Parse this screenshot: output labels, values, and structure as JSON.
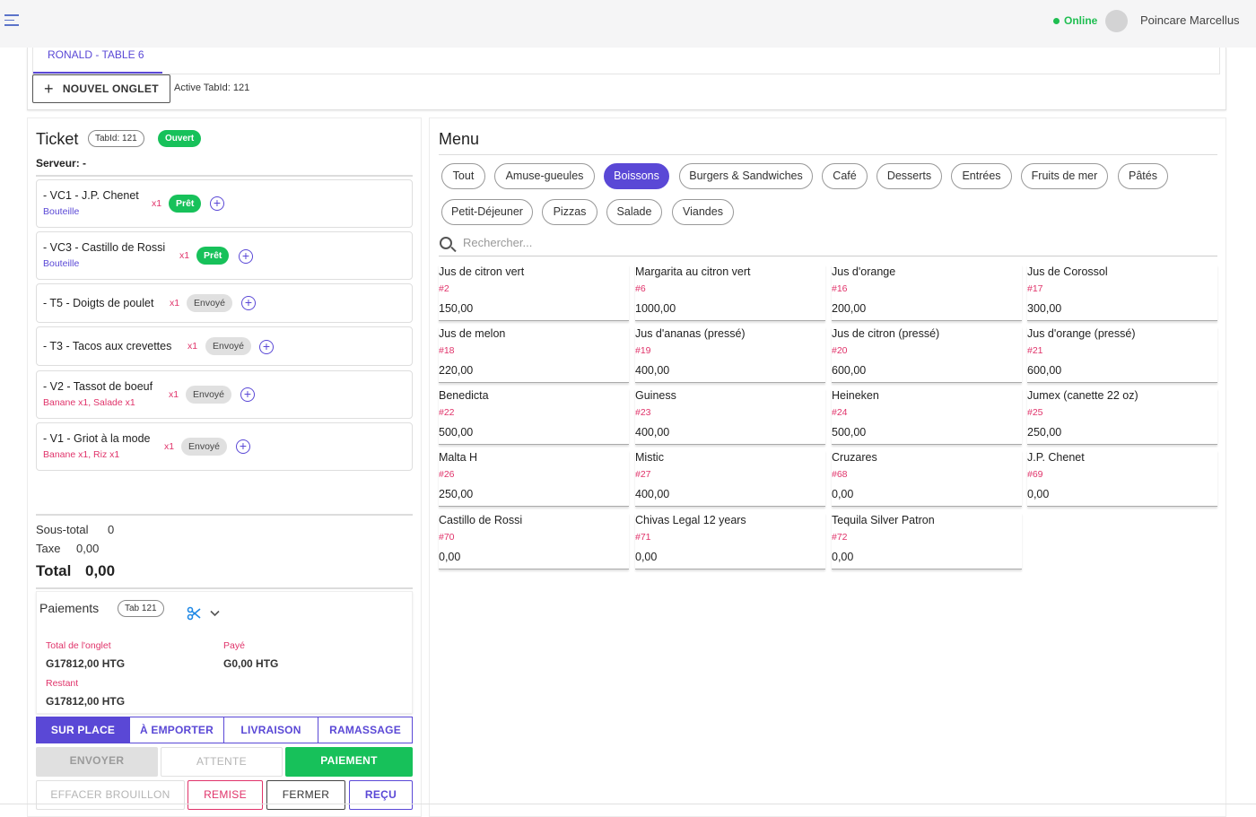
{
  "header": {
    "status": "Online",
    "user_name": "Poincare Marcellus"
  },
  "tabs": {
    "active_tab": "RONALD - TABLE 6",
    "new_tab_label": "NOUVEL ONGLET",
    "active_tabid_text": "Active TabId: 121"
  },
  "ticket": {
    "title": "Ticket",
    "tabid_chip": "TabId: 121",
    "status_chip": "Ouvert",
    "server": "Serveur: -",
    "items": [
      {
        "name": "- VC1 - J.P. Chenet",
        "sub": "Bouteille",
        "qty": "x1",
        "badge": "Prêt"
      },
      {
        "name": "- VC3 - Castillo de Rossi",
        "sub": "Bouteille",
        "qty": "x1",
        "badge": "Prêt"
      },
      {
        "name": "- T5 - Doigts de poulet",
        "sub": "",
        "qty": "x1",
        "badge": "Envoyé"
      },
      {
        "name": "- T3 - Tacos aux crevettes",
        "sub": "",
        "qty": "x1",
        "badge": "Envoyé"
      },
      {
        "name": "- V2 - Tassot de boeuf",
        "sub": "Banane x1, Salade x1",
        "qty": "x1",
        "badge": "Envoyé"
      },
      {
        "name": "- V1 - Griot à la mode",
        "sub": "Banane x1, Riz x1",
        "qty": "x1",
        "badge": "Envoyé"
      }
    ],
    "subtotal_label": "Sous-total",
    "subtotal_value": "0",
    "tax_label": "Taxe",
    "tax_value": "0,00",
    "total_label": "Total",
    "total_value": "0,00"
  },
  "payments": {
    "title": "Paiements",
    "tab_chip": "Tab 121",
    "tab_total_label": "Total de l'onglet",
    "tab_total_value": "G17812,00 HTG",
    "paid_label": "Payé",
    "paid_value": "G0,00 HTG",
    "remaining_label": "Restant",
    "remaining_value": "G17812,00 HTG"
  },
  "order_types": [
    "SUR PLACE",
    "À EMPORTER",
    "LIVRAISON",
    "RAMASSAGE"
  ],
  "actions": {
    "send": "ENVOYER",
    "hold": "ATTENTE",
    "pay": "PAIEMENT",
    "clear_draft": "EFFACER BROUILLON",
    "discount": "REMISE",
    "close": "FERMER",
    "receipt": "REÇU"
  },
  "menu": {
    "title": "Menu",
    "categories": [
      "Tout",
      "Amuse-gueules",
      "Boissons",
      "Burgers & Sandwiches",
      "Café",
      "Desserts",
      "Entrées",
      "Fruits de mer",
      "Pâtés",
      "Petit-Déjeuner",
      "Pizzas",
      "Salade",
      "Viandes"
    ],
    "active_category": "Boissons",
    "search_placeholder": "Rechercher...",
    "items": [
      {
        "name": "Jus de citron vert",
        "code": "#2",
        "price": "150,00"
      },
      {
        "name": "Margarita au citron vert",
        "code": "#6",
        "price": "1000,00"
      },
      {
        "name": "Jus d'orange",
        "code": "#16",
        "price": "200,00"
      },
      {
        "name": "Jus de Corossol",
        "code": "#17",
        "price": "300,00"
      },
      {
        "name": "Jus de melon",
        "code": "#18",
        "price": "220,00"
      },
      {
        "name": "Jus d'ananas (pressé)",
        "code": "#19",
        "price": "400,00"
      },
      {
        "name": "Jus de citron (pressé)",
        "code": "#20",
        "price": "600,00"
      },
      {
        "name": "Jus d'orange (pressé)",
        "code": "#21",
        "price": "600,00"
      },
      {
        "name": "Benedicta",
        "code": "#22",
        "price": "500,00"
      },
      {
        "name": "Guiness",
        "code": "#23",
        "price": "400,00"
      },
      {
        "name": "Heineken",
        "code": "#24",
        "price": "500,00"
      },
      {
        "name": "Jumex (canette 22 oz)",
        "code": "#25",
        "price": "250,00"
      },
      {
        "name": "Malta H",
        "code": "#26",
        "price": "250,00"
      },
      {
        "name": "Mistic",
        "code": "#27",
        "price": "400,00"
      },
      {
        "name": "Cruzares",
        "code": "#68",
        "price": "0,00"
      },
      {
        "name": "J.P. Chenet",
        "code": "#69",
        "price": "0,00"
      },
      {
        "name": "Castillo de Rossi",
        "code": "#70",
        "price": "0,00"
      },
      {
        "name": "Chivas Legal 12 years",
        "code": "#71",
        "price": "0,00"
      },
      {
        "name": "Tequila Silver Patron",
        "code": "#72",
        "price": "0,00"
      }
    ]
  },
  "colors": {
    "accent": "#5a48d6",
    "success": "#17c15a",
    "pink": "#e0336a"
  }
}
